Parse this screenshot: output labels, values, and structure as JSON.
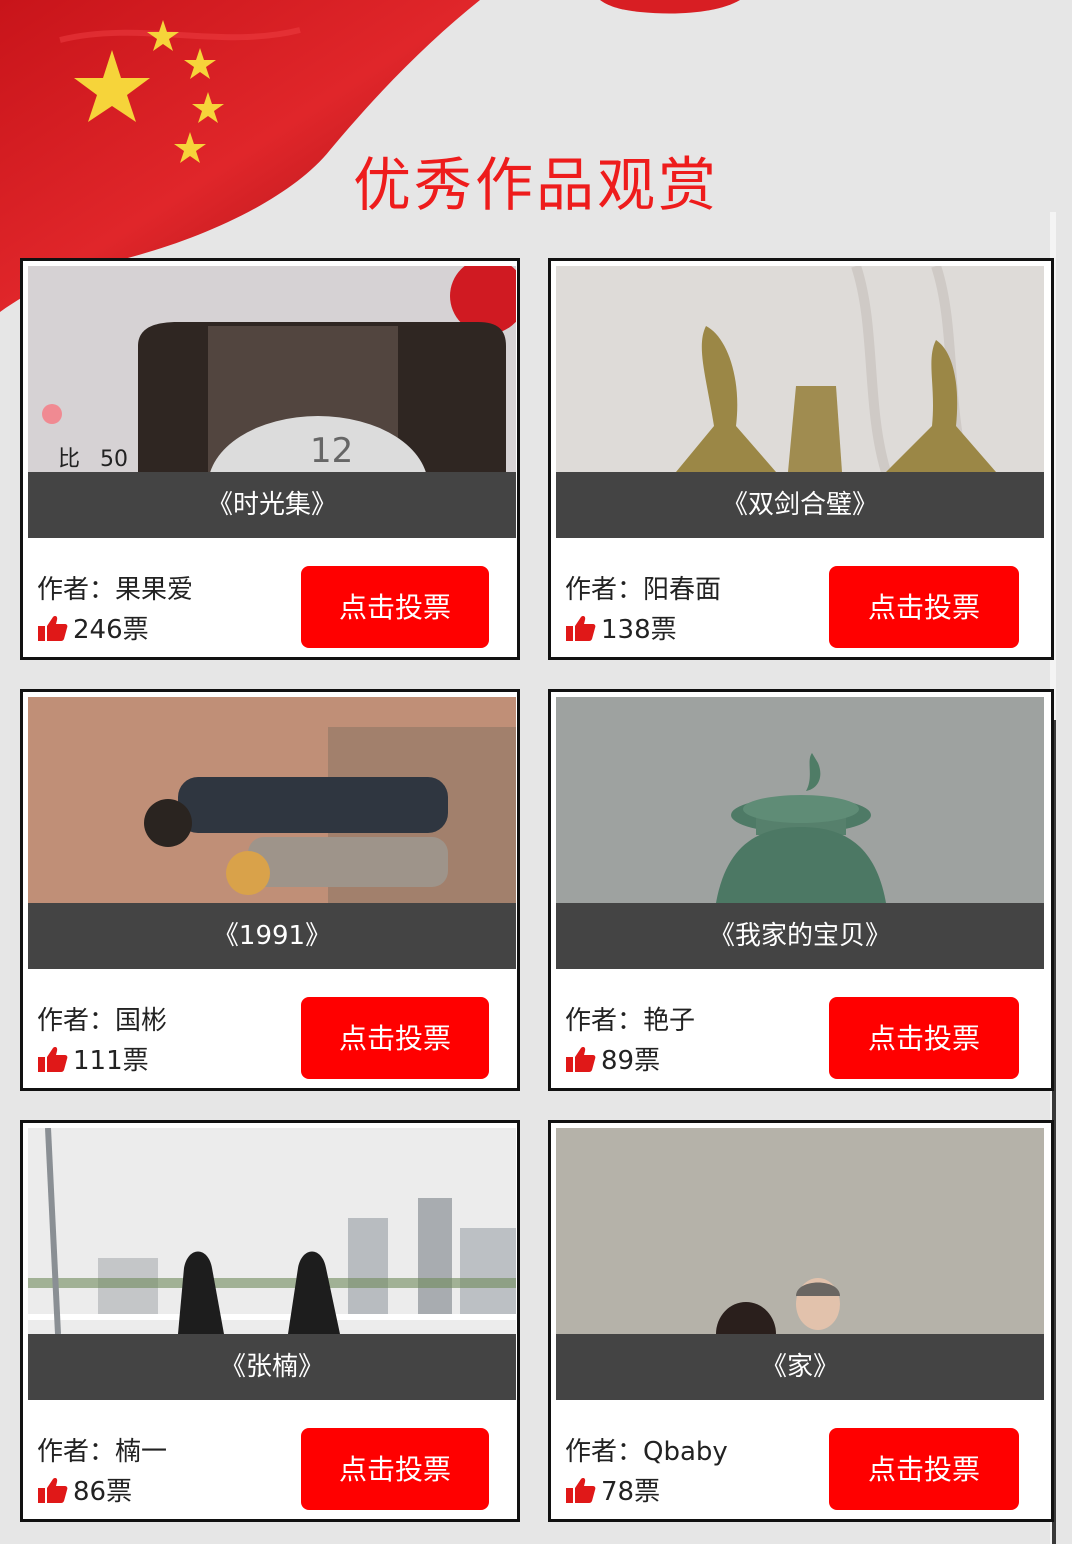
{
  "page": {
    "title": "优秀作品观赏"
  },
  "theme": {
    "accent": "#ff0000",
    "title_color": "#ee1c1c",
    "caption_bg": "#444444"
  },
  "banner": {
    "icon": "chinese-flag-icon"
  },
  "vote_icon": "thumbs-up-icon",
  "works": [
    {
      "title": "《时光集》",
      "author": "作者：果果爱",
      "votes": "246票",
      "button": "点击投票"
    },
    {
      "title": "《双剑合璧》",
      "author": "作者：阳春面",
      "votes": "138票",
      "button": "点击投票"
    },
    {
      "title": "《1991》",
      "author": "作者：国彬",
      "votes": "111票",
      "button": "点击投票"
    },
    {
      "title": "《我家的宝贝》",
      "author": "作者：艳子",
      "votes": "89票",
      "button": "点击投票"
    },
    {
      "title": "《张楠》",
      "author": "作者：楠一",
      "votes": "86票",
      "button": "点击投票"
    },
    {
      "title": "《家》",
      "author": "作者：Qbaby",
      "votes": "78票",
      "button": "点击投票"
    }
  ]
}
